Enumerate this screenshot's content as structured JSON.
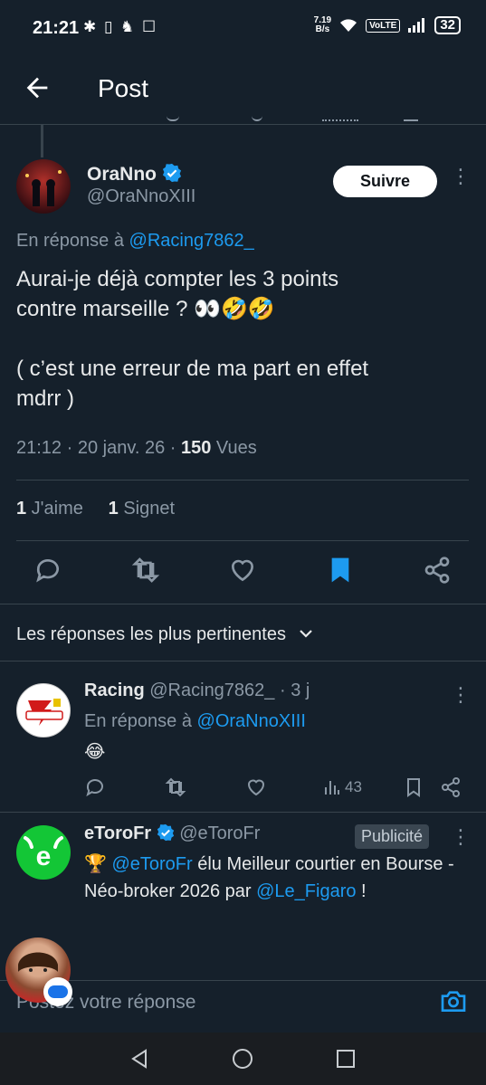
{
  "status_bar": {
    "time": "21:21",
    "left_icons": "✱ ▯ ♞ ☐",
    "speed_top": "7.19",
    "speed_bottom": "B/s",
    "volte": "VoLTE",
    "battery": "32"
  },
  "header": {
    "title": "Post"
  },
  "post": {
    "author_name": "OraNno",
    "author_handle": "@OraNnoXIII",
    "follow_label": "Suivre",
    "reply_prefix": "En réponse à ",
    "reply_to": "@Racing7862_",
    "text": "Aurai-je déjà compter les 3 points\ncontre marseille ? 👀🤣🤣\n\n( c’est une erreur de ma part en effet\nmdrr )",
    "time": "21:12",
    "sep1": " · ",
    "date": "20 janv. 26",
    "sep2": " · ",
    "views_count": "150",
    "views_label": " Vues",
    "likes_count": "1",
    "likes_label": " J'aime",
    "bookmarks_count": "1",
    "bookmarks_label": " Signet"
  },
  "replies_section": {
    "title": "Les réponses les plus pertinentes"
  },
  "reply": {
    "author_name": "Racing",
    "author_handle": "@Racing7862_",
    "age": " · 3 j",
    "reply_prefix": "En réponse à ",
    "reply_to": "@OraNnoXIII",
    "text": "😂",
    "views": "43"
  },
  "ad": {
    "author_name": "eToroFr",
    "author_handle": "@eToroFr",
    "badge": "Publicité",
    "trophy": "🏆",
    "mention": "@eToroFr",
    "text1": " élu Meilleur courtier en Bourse - Néo-broker 2026 par ",
    "mention2": "@Le_Figaro",
    "text2": " !"
  },
  "composer": {
    "placeholder": "Postez votre réponse"
  },
  "colors": {
    "background": "#15202b",
    "accent": "#1d9bf0",
    "text": "#e7e9ea",
    "muted": "#8b98a5"
  }
}
